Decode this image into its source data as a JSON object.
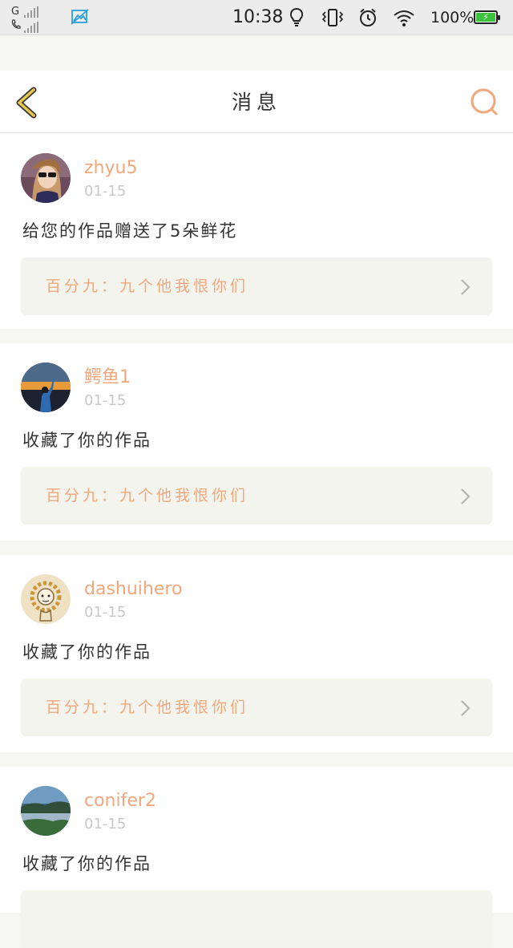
{
  "status_bar": {
    "carrier1": "G",
    "time": "10:38",
    "battery": "100%"
  },
  "header": {
    "title": "消息"
  },
  "messages": [
    {
      "username": "zhyu5",
      "date": "01-15",
      "text": "给您的作品赠送了5朵鲜花",
      "work": "百分九：九个他我恨你们"
    },
    {
      "username": "鳄鱼1",
      "date": "01-15",
      "text": "收藏了你的作品",
      "work": "百分九：九个他我恨你们"
    },
    {
      "username": "dashuihero",
      "date": "01-15",
      "text": "收藏了你的作品",
      "work": "百分九：九个他我恨你们"
    },
    {
      "username": "conifer2",
      "date": "01-15",
      "text": "收藏了你的作品",
      "work": ""
    }
  ],
  "icons": {
    "back": "chevron-left-icon",
    "search": "search-icon",
    "work_arrow": "chevron-right-icon"
  },
  "colors": {
    "accent": "#f0a77c",
    "back_icon": "#e8c94a",
    "card_link_bg": "#f4f4ee"
  }
}
